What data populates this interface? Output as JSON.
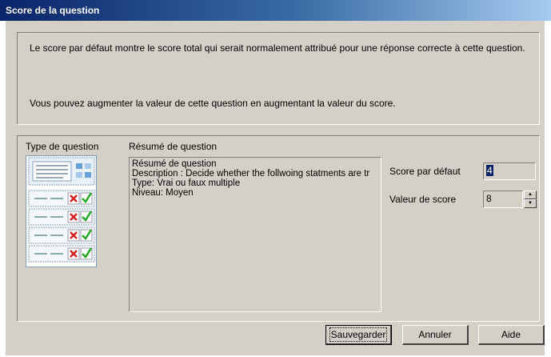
{
  "window": {
    "title": "Score de la question"
  },
  "info": {
    "line1": "Le score par défaut montre le score total qui serait normalement attribué pour une réponse correcte à cette question.",
    "line2": "Vous pouvez augmenter la valeur de cette question en augmentant la valeur du score."
  },
  "question_type": {
    "label": "Type de question",
    "icon": "true-false-multiple-icon"
  },
  "summary": {
    "label": "Résumé de question",
    "lines": [
      "Résumé de question",
      "Description : Decide whether the follwoing statments are tr",
      "Type: Vrai ou faux multiple",
      "Niveau: Moyen"
    ]
  },
  "score": {
    "default_label": "Score par défaut",
    "default_value": "4",
    "value_label": "Valeur de score",
    "value": "8"
  },
  "buttons": {
    "save": "Sauvegarder",
    "cancel": "Annuler",
    "help": "Aide"
  },
  "colors": {
    "title_start": "#0a246a",
    "title_end": "#a6caf0",
    "face": "#d4d0c8",
    "check": "#22aa22",
    "cross": "#d42020"
  }
}
